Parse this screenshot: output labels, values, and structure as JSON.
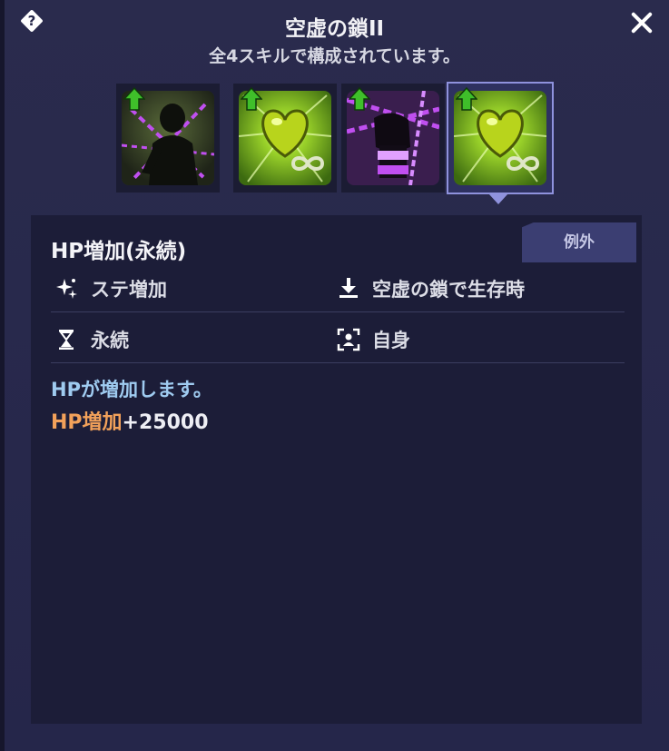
{
  "header": {
    "title": "空虚の鎖II",
    "subtitle": "全4スキルで構成されています。",
    "help_icon": "question-diamond-icon",
    "close_icon": "close-icon"
  },
  "skills": [
    {
      "name": "chain-shadow-figure",
      "selected": false
    },
    {
      "name": "heart-infinity",
      "selected": false
    },
    {
      "name": "chain-fist",
      "selected": false
    },
    {
      "name": "heart-infinity",
      "selected": true
    }
  ],
  "detail": {
    "skill_name": "HP増加(永続)",
    "tag": "例外",
    "attributes": {
      "type": {
        "icon": "sparkle-stat-icon",
        "label": "ステ増加"
      },
      "condition": {
        "icon": "download-arrow-icon",
        "label": "空虚の鎖で生存時"
      },
      "duration": {
        "icon": "hourglass-icon",
        "label": "永続"
      },
      "target": {
        "icon": "target-self-icon",
        "label": "自身"
      }
    },
    "description": "HPが増加します。",
    "effect_key": "HP増加",
    "effect_value": "+25000"
  },
  "colors": {
    "background": "#262748",
    "detail_panel": "#1c1d38",
    "description_blue": "#9fcbf0",
    "effect_orange": "#f2a15a",
    "selected_border": "#8f92dd",
    "skill_green": "#9bd32a",
    "chain_purple": "#c04ff0"
  }
}
